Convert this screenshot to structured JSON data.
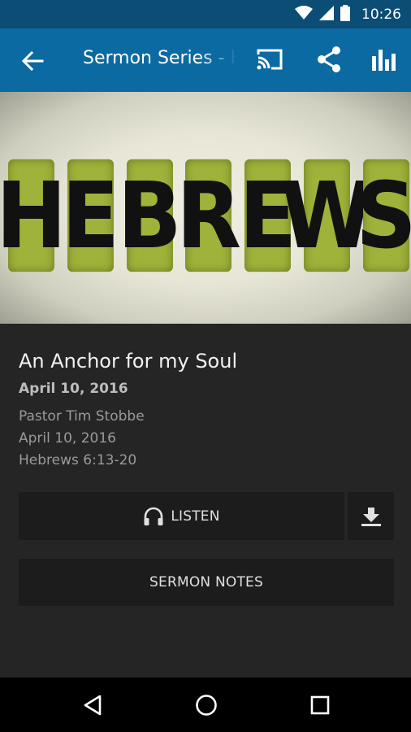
{
  "status_bar": {
    "time": "10:26"
  },
  "app_bar": {
    "title": "Sermon Series - Hebrews"
  },
  "hero": {
    "letters": [
      "H",
      "E",
      "B",
      "R",
      "E",
      "W",
      "S"
    ]
  },
  "sermon": {
    "title": "An Anchor for my Soul",
    "date": "April 10, 2016",
    "speaker": "Pastor Tim Stobbe",
    "meta_date": "April 10, 2016",
    "passage": "Hebrews 6:13-20"
  },
  "actions": {
    "listen_label": "LISTEN",
    "notes_label": "SERMON NOTES"
  },
  "colors": {
    "status_bar": "#0b4d75",
    "app_bar": "#0c6aa3",
    "background": "#252525",
    "button": "#1c1c1c",
    "tile": "#9fb23a"
  }
}
